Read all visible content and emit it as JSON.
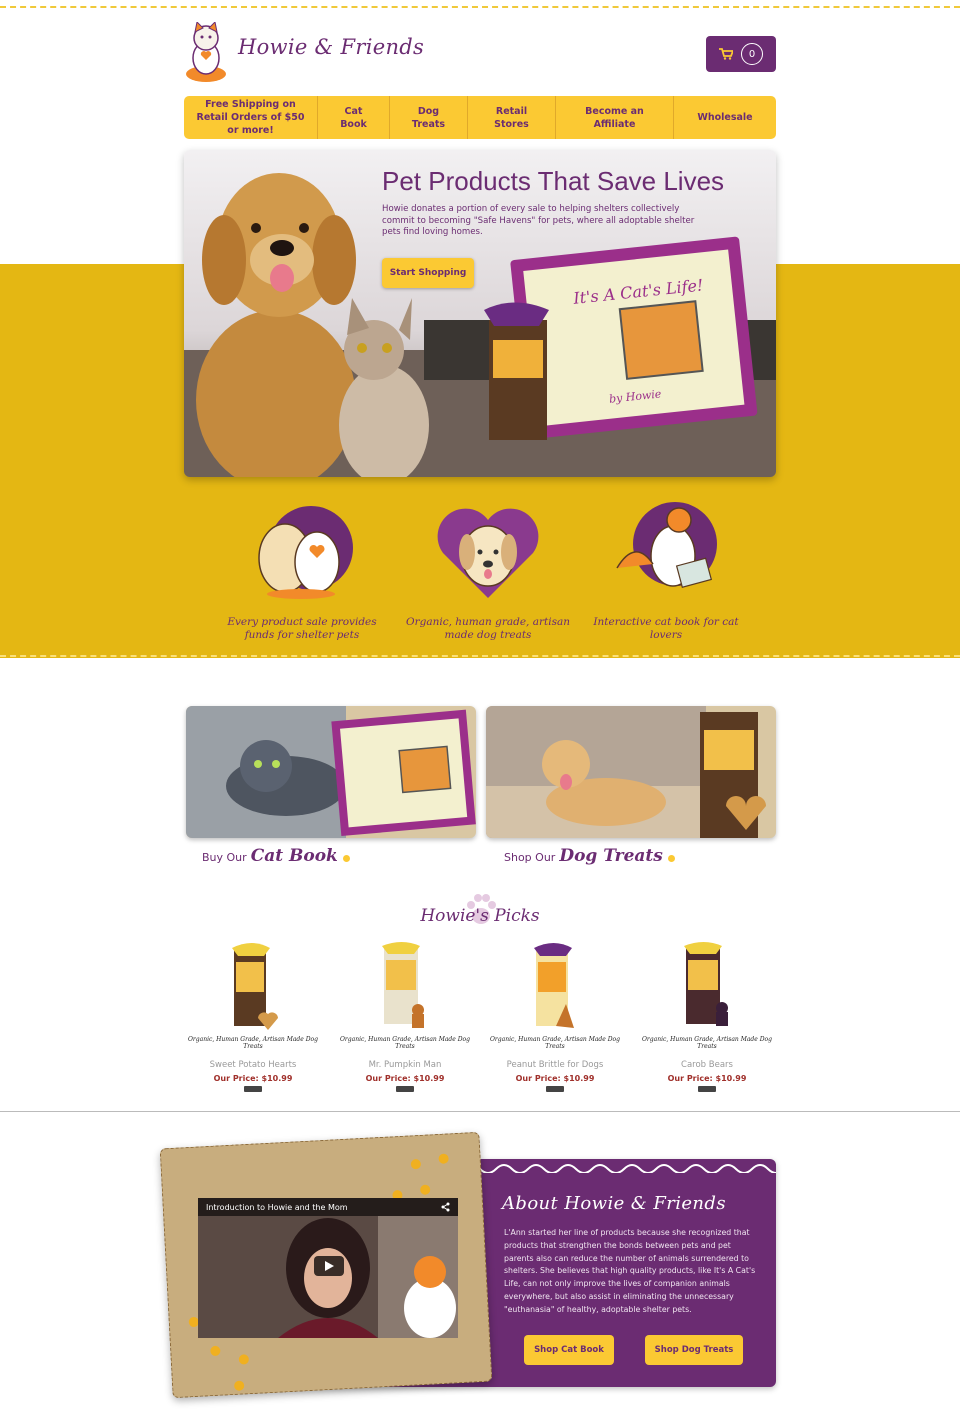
{
  "brand": {
    "name": "Howie & Friends",
    "purple": "#6b2c72",
    "yellow": "#fbc933",
    "mustard": "#e4b713"
  },
  "cart": {
    "count": "0",
    "icon": "cart-icon"
  },
  "nav": {
    "items": [
      "Free Shipping on Retail Orders of $50 or more!",
      "Cat Book",
      "Dog Treats",
      "Retail Stores",
      "Become an Affiliate",
      "Wholesale"
    ]
  },
  "hero": {
    "title": "Pet Products That Save Lives",
    "body": "Howie donates a portion of every sale to helping shelters collectively commit to becoming \"Safe Havens\" for pets, where all adoptable shelter pets find loving homes.",
    "cta": "Start Shopping"
  },
  "features": [
    {
      "text": "Every product sale provides funds for shelter pets"
    },
    {
      "text": "Organic, human grade, artisan made dog treats"
    },
    {
      "text": "Interactive cat book for cat lovers"
    }
  ],
  "promos": [
    {
      "prefix": "Buy Our",
      "label": "Cat Book"
    },
    {
      "prefix": "Shop Our",
      "label": "Dog Treats"
    }
  ],
  "picks": {
    "title": "Howie's Picks",
    "items": [
      {
        "tag": "Organic, Human Grade, Artisan Made Dog Treats",
        "name": "Sweet Potato Hearts",
        "price": "Our Price: $10.99"
      },
      {
        "tag": "Organic, Human Grade, Artisan Made Dog Treats",
        "name": "Mr. Pumpkin Man",
        "price": "Our Price: $10.99"
      },
      {
        "tag": "Organic, Human Grade, Artisan Made Dog Treats",
        "name": "Peanut Brittle for Dogs",
        "price": "Our Price: $10.99"
      },
      {
        "tag": "Organic, Human Grade, Artisan Made Dog Treats",
        "name": "Carob Bears",
        "price": "Our Price: $10.99"
      }
    ]
  },
  "about": {
    "title": "About Howie & Friends",
    "body": "L'Ann started her line of products because she recognized that products that strengthen the bonds between pets and pet parents also can reduce the number of animals surrendered to shelters. She believes that high quality products, like It's A Cat's Life, can not only improve the lives of companion animals everywhere, but also assist in eliminating the unnecessary \"euthanasia\" of healthy, adoptable shelter pets.",
    "buttons": [
      "Shop Cat Book",
      "Shop Dog Treats"
    ],
    "video_title": "Introduction to Howie and the Mom"
  }
}
